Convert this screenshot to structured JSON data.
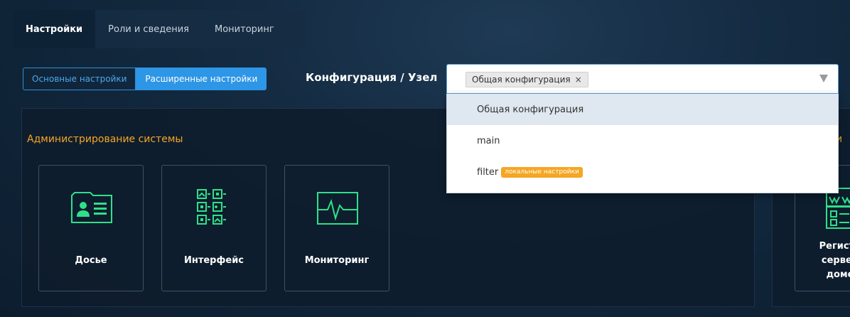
{
  "tabs": [
    {
      "label": "Настройки",
      "active": true
    },
    {
      "label": "Роли и сведения",
      "active": false
    },
    {
      "label": "Мониторинг",
      "active": false
    }
  ],
  "mode_toggle": {
    "basic_label": "Основные настройки",
    "advanced_label": "Расширенные настройки",
    "selected": "advanced"
  },
  "config": {
    "label": "Конфигурация / Узел",
    "selected_chip": "Общая конфигурация",
    "chip_remove": "×",
    "options": [
      {
        "label": "Общая конфигурация",
        "badge": "",
        "highlighted": true
      },
      {
        "label": "main",
        "badge": "",
        "highlighted": false
      },
      {
        "label": "filter",
        "badge": "локальные настройки",
        "highlighted": false
      }
    ]
  },
  "admin_panel": {
    "title": "Администрирование системы",
    "cards": [
      {
        "label": "Досье",
        "icon": "dossier-icon"
      },
      {
        "label": "Интерфейс",
        "icon": "interface-icon"
      },
      {
        "label": "Мониторинг",
        "icon": "monitoring-icon"
      }
    ]
  },
  "right_panel": {
    "title_fragment": "фи",
    "card_label_lines": [
      "Регистр",
      "сервер",
      "доме"
    ],
    "icon": "www-server-icon"
  },
  "colors": {
    "accent_blue": "#2e96e6",
    "title_orange": "#f5a623",
    "icon_green": "#2ee08a",
    "badge_orange": "#f5a623"
  }
}
